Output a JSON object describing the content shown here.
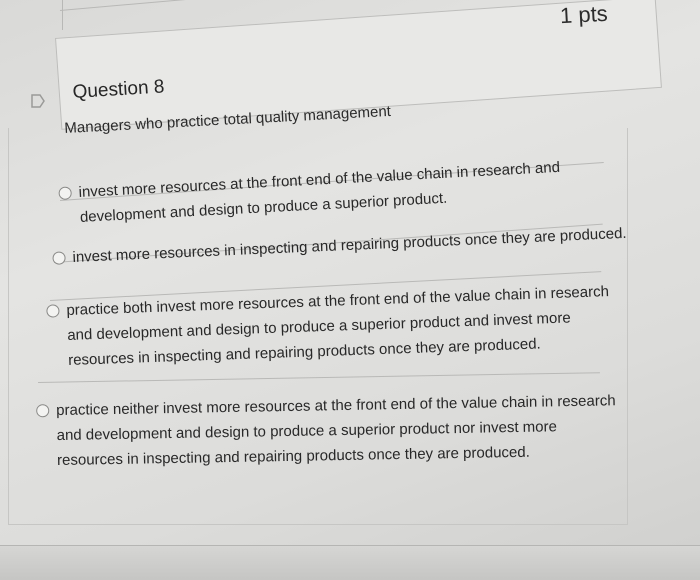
{
  "question": {
    "points": "1 pts",
    "title": "Question 8",
    "prompt": "Managers who practice total quality management"
  },
  "answers": [
    {
      "label": "invest more resources at the front end of the value chain in research and\ndevelopment and design to produce a superior product."
    },
    {
      "label": "invest more resources in inspecting and repairing products once they are produced."
    },
    {
      "label": "practice both invest more resources at the front end of the value chain in research\nand development and design to produce a superior product and invest more\nresources in inspecting and repairing products once they are produced."
    },
    {
      "label": "practice neither invest more resources at the front end of the value chain in research\nand development and design to produce a superior product nor invest more\nresources in inspecting and repairing products once they are produced."
    }
  ],
  "icons": {
    "flag": "flag-icon",
    "radio": "radio-button"
  }
}
